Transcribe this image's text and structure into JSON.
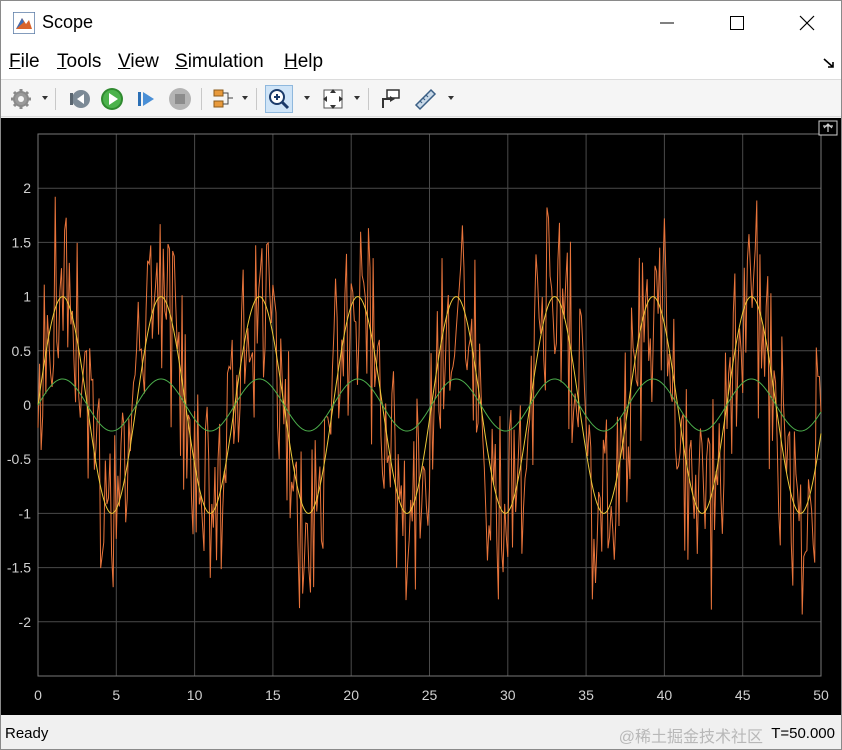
{
  "window": {
    "title": "Scope"
  },
  "menu": [
    {
      "label": "File",
      "ul": "F",
      "rest": "ile"
    },
    {
      "label": "Tools",
      "ul": "T",
      "rest": "ools"
    },
    {
      "label": "View",
      "ul": "V",
      "rest": "iew"
    },
    {
      "label": "Simulation",
      "ul": "S",
      "rest": "imulation"
    },
    {
      "label": "Help",
      "ul": "H",
      "rest": "elp"
    }
  ],
  "toolbar": {
    "icons": [
      "gear-icon",
      "step-back-icon",
      "run-icon",
      "step-forward-icon",
      "stop-icon",
      "signal-selector-icon",
      "zoom-in-icon",
      "autoscale-icon",
      "highlight-simulink-block-icon",
      "measurements-icon"
    ],
    "zoom_active": true
  },
  "status": {
    "state": "Ready",
    "time": "T=50.000",
    "watermark": "@稀土掘金技术社区"
  },
  "colors": {
    "background": "#000000",
    "grid": "#4a4a4a",
    "tick_text": "#d0d0d0",
    "orange": "#e8743b",
    "yellow": "#edc93a",
    "green": "#4cae4c"
  },
  "chart_data": {
    "type": "line",
    "title": "",
    "xlabel": "",
    "ylabel": "",
    "xlim": [
      0,
      50
    ],
    "ylim": [
      -2.5,
      2.5
    ],
    "xticks": [
      "0",
      "5",
      "10",
      "15",
      "20",
      "25",
      "30",
      "35",
      "40",
      "45",
      "50"
    ],
    "yticks": [
      "2",
      "1.5",
      "1",
      "0.5",
      "0",
      "-0.5",
      "-1",
      "-1.5",
      "-2"
    ],
    "grid": true,
    "legend": "none",
    "series": [
      {
        "color": "orange",
        "formula": "sin(t) + sin(4*t) noise-like",
        "amplitude": 2.0,
        "period": 6.283
      },
      {
        "color": "yellow",
        "formula": "sin(t)",
        "amplitude": 1.0,
        "period": 6.283
      },
      {
        "color": "green",
        "formula": "0.24*sin(t)",
        "amplitude": 0.24,
        "period": 6.283
      }
    ]
  }
}
